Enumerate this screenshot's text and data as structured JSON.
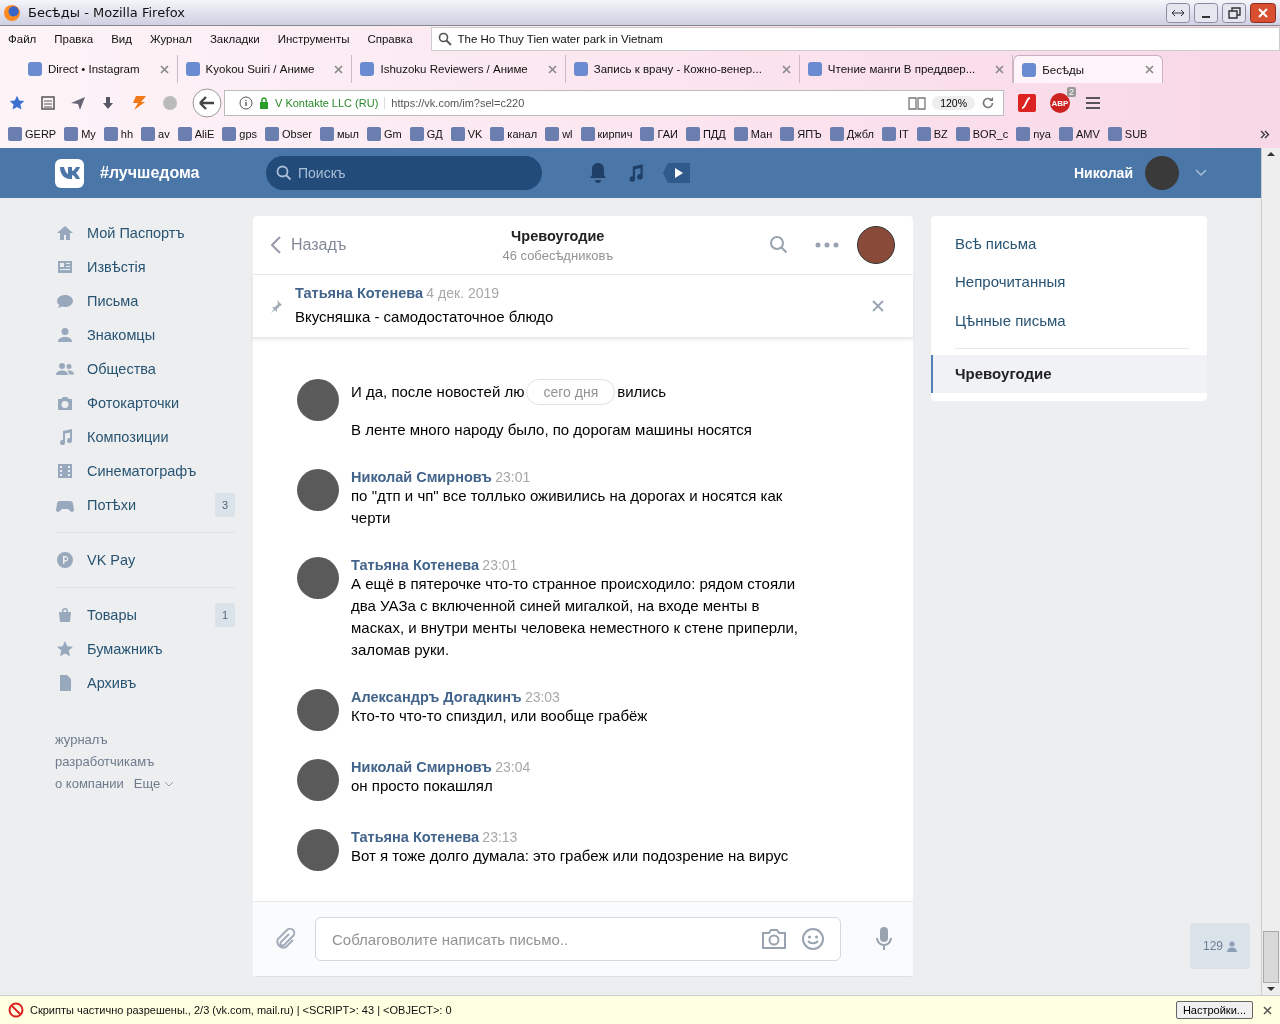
{
  "window": {
    "title": "Бесѣды - Mozilla Firefox"
  },
  "menu": [
    "Файл",
    "Правка",
    "Вид",
    "Журнал",
    "Закладки",
    "Инструменты",
    "Справка"
  ],
  "search_bar": {
    "value": "The Ho Thuy Tien water park in Vietnam"
  },
  "tabs": [
    {
      "label": "Direct • Instagram",
      "selected": false
    },
    {
      "label": "Kyokou Suiri / Аниме",
      "selected": false
    },
    {
      "label": "Ishuzoku Reviewers / Аниме",
      "selected": false
    },
    {
      "label": "Запись к врачу - Кожно-венер...",
      "selected": false
    },
    {
      "label": "Чтение манги В преддвер...",
      "selected": false
    },
    {
      "label": "Бесѣды",
      "selected": true
    }
  ],
  "nav": {
    "identity": "V Kontakte LLC (RU)",
    "url": "https://vk.com/im?sel=c220",
    "zoom": "120%",
    "abp_label": "ABP",
    "abp_count": "2"
  },
  "bookmarks": [
    "GERP",
    "My",
    "hh",
    "av",
    "AliE",
    "gps",
    "Obser",
    "мыл",
    "Gm",
    "GД",
    "VK",
    "канал",
    "wl",
    "кирпич",
    "ГАИ",
    "ПДД",
    "Ман",
    "ЯПЪ",
    "Джбл",
    "IT",
    "BZ",
    "BOR_c",
    "nya",
    "AMV",
    "SUB"
  ],
  "vk_header": {
    "title": "#лучшедома",
    "search_placeholder": "Поискъ",
    "user": "Николай"
  },
  "sidebar": {
    "groups": [
      [
        {
          "label": "Мой Паспортъ",
          "kind": "home"
        },
        {
          "label": "Извѣстія",
          "kind": "news"
        },
        {
          "label": "Письма",
          "kind": "messages"
        },
        {
          "label": "Знакомцы",
          "kind": "friends"
        },
        {
          "label": "Общества",
          "kind": "groups"
        },
        {
          "label": "Фотокарточки",
          "kind": "photos"
        },
        {
          "label": "Композиции",
          "kind": "music"
        },
        {
          "label": "Синематографъ",
          "kind": "video"
        },
        {
          "label": "Потѣхи",
          "kind": "games",
          "count": "3"
        }
      ],
      [
        {
          "label": "VK Pay",
          "kind": "pay"
        }
      ],
      [
        {
          "label": "Товары",
          "kind": "market",
          "count": "1"
        },
        {
          "label": "Бумажникъ",
          "kind": "star"
        },
        {
          "label": "Архивъ",
          "kind": "archive"
        }
      ]
    ],
    "footer": [
      "журналъ",
      "разработчикамъ",
      "о компании",
      "Еще"
    ]
  },
  "chat": {
    "back": "Назадъ",
    "title": "Чревоугодие",
    "subtitle": "46 собесѣдниковъ",
    "pinned": {
      "author": "Татьяна Котенева",
      "date": "4 дек. 2019",
      "text": "Вкусняшка - самодостаточное блюдо"
    },
    "partial": {
      "before_badge": "И да, после новостей лю",
      "badge": "сего дня",
      "after_badge": "вились",
      "text": "В ленте много народу было, по дорогам машины носятся"
    },
    "messages": [
      {
        "author": "Николай Смирновъ",
        "time": "23:01",
        "text": "по \"дтп и чп\" все толлько оживились на дорогах и носятся как черти"
      },
      {
        "author": "Татьяна Котенева",
        "time": "23:01",
        "text": "А ещё в пятерочке что-то странное происходило: рядом стояли два УАЗа с включенной синей мигалкой, на входе менты в масках, и внутри менты человека неместного к стене приперли, заломав руки."
      },
      {
        "author": "Александръ Догадкинъ",
        "time": "23:03",
        "text": "Кто-то что-то спиздил, или вообще грабёж"
      },
      {
        "author": "Николай Смирновъ",
        "time": "23:04",
        "text": "он просто покашлял"
      },
      {
        "author": "Татьяна Котенева",
        "time": "23:13",
        "text": "Вот я тоже долго думала: это грабеж или подозрение на вирус"
      }
    ],
    "composer_placeholder": "Соблаговолите написать письмо.."
  },
  "folders": [
    {
      "label": "Всѣ письма",
      "selected": false
    },
    {
      "label": "Непрочитанныя",
      "selected": false
    },
    {
      "label": "Цѣнные письма",
      "selected": false
    },
    {
      "label": "Чревоугодие",
      "selected": true
    }
  ],
  "online_count": "129",
  "status_bar": {
    "text": "Скрипты частично разрешены., 2/3 (vk.com, mail.ru) | <SCRIPT>: 43 | <OBJECT>: 0",
    "button": "Настройки..."
  }
}
